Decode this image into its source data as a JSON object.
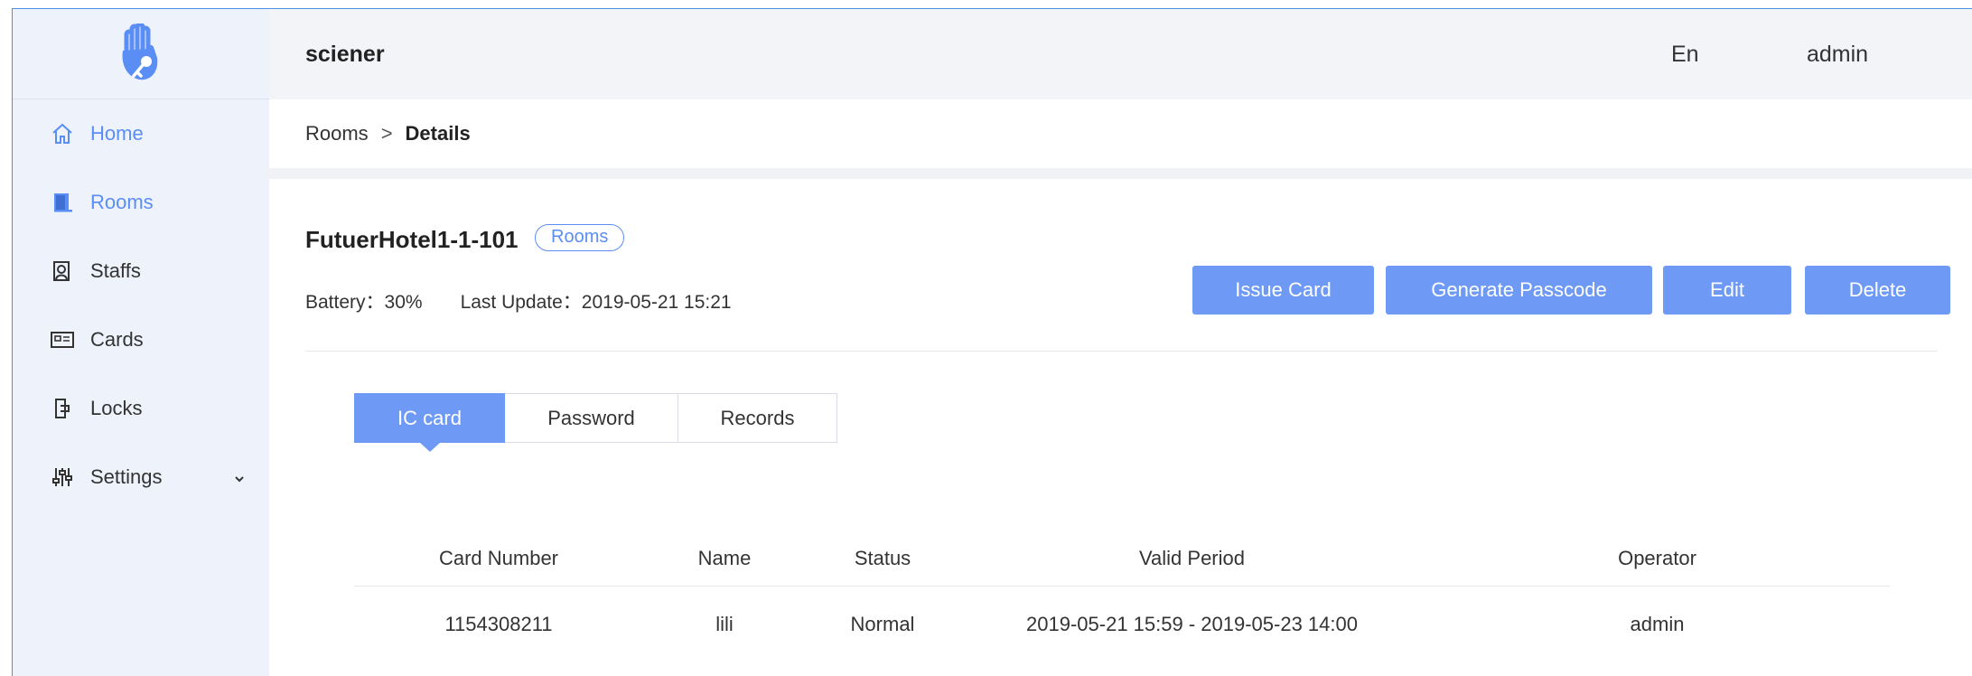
{
  "sidebar": {
    "items": [
      {
        "label": "Home",
        "icon": "home-icon"
      },
      {
        "label": "Rooms",
        "icon": "door-icon"
      },
      {
        "label": "Staffs",
        "icon": "staff-icon"
      },
      {
        "label": "Cards",
        "icon": "card-icon"
      },
      {
        "label": "Locks",
        "icon": "lock-icon"
      },
      {
        "label": "Settings",
        "icon": "settings-icon"
      }
    ]
  },
  "header": {
    "brand": "sciener",
    "language": "En",
    "user": "admin"
  },
  "breadcrumb": {
    "parent": "Rooms",
    "separator": ">",
    "current": "Details"
  },
  "room": {
    "title": "FutuerHotel1-1-101",
    "tag": "Rooms",
    "battery_label": "Battery：30%",
    "last_update_label": "Last Update：2019-05-21 15:21"
  },
  "actions": {
    "issue_card": "Issue Card",
    "generate_passcode": "Generate Passcode",
    "edit": "Edit",
    "delete": "Delete"
  },
  "tabs": [
    "IC card",
    "Password",
    "Records"
  ],
  "table": {
    "columns": [
      "Card Number",
      "Name",
      "Status",
      "Valid Period",
      "Operator"
    ],
    "rows": [
      [
        "1154308211",
        "lili",
        "Normal",
        "2019-05-21 15:59 - 2019-05-23 14:00",
        "admin"
      ]
    ]
  },
  "colors": {
    "accent": "#6e9af6",
    "active_nav": "#5b8ef5",
    "sidebar_bg": "#eef2fb",
    "header_bg": "#f2f4f8"
  }
}
